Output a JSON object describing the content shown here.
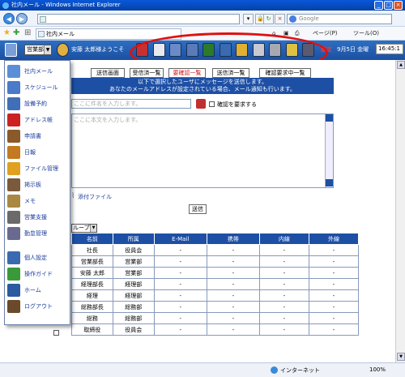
{
  "window": {
    "title": "社内メール - Windows Internet Explorer"
  },
  "browser": {
    "google_placeholder": "Google",
    "tab_label": "社内メール",
    "page_menu": "ページ(P)",
    "tools_menu": "ツール(O)"
  },
  "app": {
    "dept_select": "営業部",
    "welcome": "安藤 太郎様ようこそ",
    "settings_label": "設定",
    "date": "9月5日 金曜",
    "time": "16:45:1",
    "toolbar_icons": [
      "mail-icon",
      "envelope-icon",
      "schedule-icon",
      "calendar-icon",
      "book-icon",
      "notes-icon",
      "folder-icon",
      "document-icon",
      "file-icon",
      "user-icon",
      "logout-icon"
    ]
  },
  "sidebar": {
    "items": [
      {
        "label": "社内メール",
        "icon": "mail-icon",
        "color": "#5a8fd8"
      },
      {
        "label": "スケジュール",
        "icon": "calendar-icon",
        "color": "#4a7ac8"
      },
      {
        "label": "設備予約",
        "icon": "equipment-icon",
        "color": "#3f6fb8"
      },
      {
        "label": "アドレス帳",
        "icon": "address-book-icon",
        "color": "#cc2222"
      },
      {
        "label": "申請書",
        "icon": "form-icon",
        "color": "#8a5a2a"
      },
      {
        "label": "日報",
        "icon": "report-icon",
        "color": "#c47a20"
      },
      {
        "label": "ファイル管理",
        "icon": "folder-icon",
        "color": "#e0a020"
      },
      {
        "label": "掲示板",
        "icon": "board-icon",
        "color": "#7a5a3a"
      },
      {
        "label": "メモ",
        "icon": "memo-icon",
        "color": "#aa8844"
      },
      {
        "label": "営業支援",
        "icon": "sales-icon",
        "color": "#6a6a6a"
      },
      {
        "label": "勤怠管理",
        "icon": "attendance-icon",
        "color": "#6a6a90"
      },
      {
        "label": "個人設定",
        "icon": "user-settings-icon",
        "color": "#3a6ab0"
      },
      {
        "label": "操作ガイド",
        "icon": "guide-icon",
        "color": "#3a9a3a"
      },
      {
        "label": "ホーム",
        "icon": "home-icon",
        "color": "#2a5aa0"
      },
      {
        "label": "ログアウト",
        "icon": "logout-icon",
        "color": "#6a4a2a"
      }
    ]
  },
  "tabs": [
    {
      "label": "送信画面"
    },
    {
      "label": "受信済一覧"
    },
    {
      "label": "要確認一覧"
    },
    {
      "label": "送信済一覧"
    },
    {
      "label": "確認要求中一覧"
    }
  ],
  "compose": {
    "info_line1": "以下で選択したユーザにメッセージを送信します。",
    "info_line2": "あなたのメールアドレスが設定されている場合、メール通知も行います。",
    "subject_placeholder": "ここに件名を入力します。",
    "confirm_label": "確認を要求する",
    "body_placeholder": "ここに本文を入力します。",
    "attach_label": "添付ファイル",
    "send_label": "送信"
  },
  "directory": {
    "group_select": "ループ",
    "columns": [
      "名前",
      "所属",
      "E-Mail",
      "携帯",
      "内線",
      "外線"
    ],
    "rows": [
      [
        "社長",
        "役員会",
        "-",
        "-",
        "-",
        "-"
      ],
      [
        "営業部長",
        "営業部",
        "-",
        "-",
        "-",
        "-"
      ],
      [
        "安藤 太郎",
        "営業部",
        "-",
        "-",
        "-",
        "-"
      ],
      [
        "経理部長",
        "経理部",
        "-",
        "-",
        "-",
        "-"
      ],
      [
        "経理",
        "経理部",
        "-",
        "-",
        "-",
        "-"
      ],
      [
        "総務部長",
        "総務部",
        "-",
        "-",
        "-",
        "-"
      ],
      [
        "総務",
        "総務部",
        "-",
        "-",
        "-",
        "-"
      ],
      [
        "取締役",
        "役員会",
        "-",
        "-",
        "-",
        "-"
      ]
    ]
  },
  "status": {
    "zone": "インターネット",
    "zoom": "100%"
  }
}
